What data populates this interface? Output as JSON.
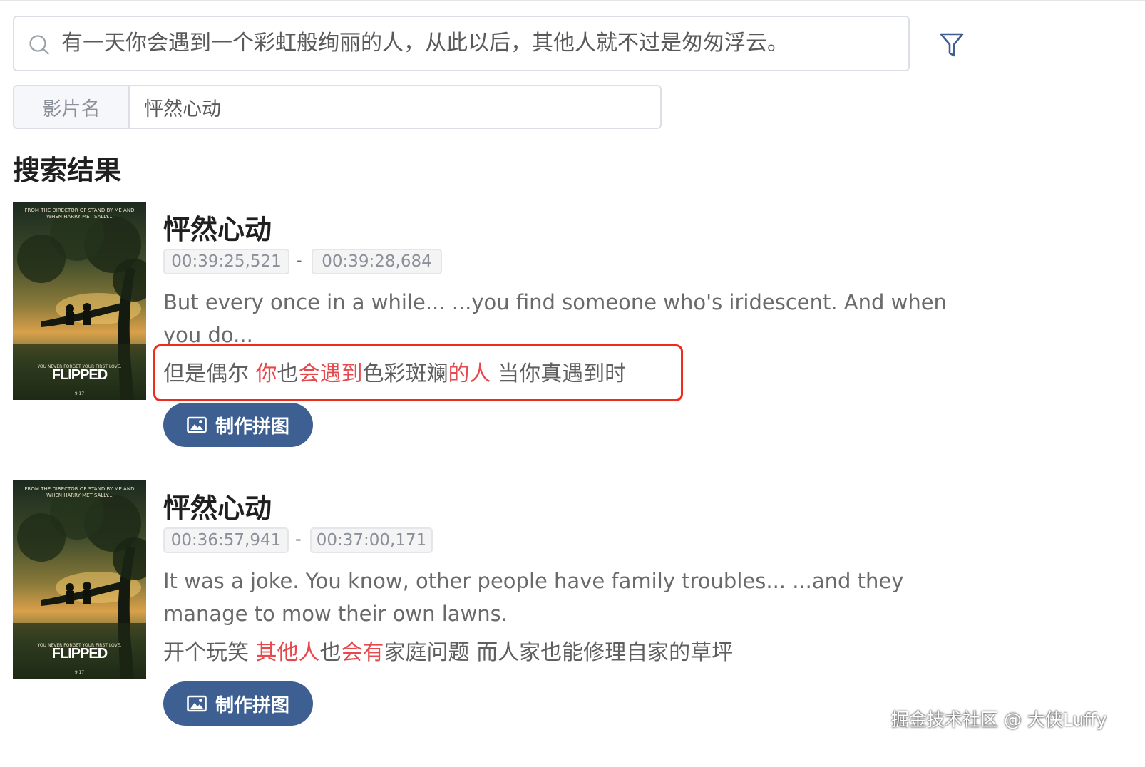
{
  "search": {
    "query": "有一天你会遇到一个彩虹般绚丽的人，从此以后，其他人就不过是匆匆浮云。",
    "title_filter_label": "影片名",
    "title_filter_value": "怦然心动"
  },
  "results_heading": "搜索结果",
  "results": [
    {
      "movie_title": "怦然心动",
      "start_time": "00:39:25,521",
      "end_time": "00:39:28,684",
      "english": "But every once in a while... ...you find someone who's iridescent. And when you do...",
      "chinese_parts": [
        {
          "text": "但是偶尔 ",
          "hl": false
        },
        {
          "text": "你",
          "hl": true
        },
        {
          "text": "也",
          "hl": false
        },
        {
          "text": "会遇到",
          "hl": true
        },
        {
          "text": "色彩斑斓",
          "hl": false
        },
        {
          "text": "的人",
          "hl": true
        },
        {
          "text": " 当你真遇到时",
          "hl": false
        }
      ],
      "button_label": "制作拼图",
      "annotated": true
    },
    {
      "movie_title": "怦然心动",
      "start_time": "00:36:57,941",
      "end_time": "00:37:00,171",
      "english": "It was a joke. You know, other people have family troubles... ...and they manage to mow their own lawns.",
      "chinese_parts": [
        {
          "text": "开个玩笑 ",
          "hl": false
        },
        {
          "text": "其他人",
          "hl": true
        },
        {
          "text": "也",
          "hl": false
        },
        {
          "text": "会有",
          "hl": true
        },
        {
          "text": "家庭问题 而人家也能修理自家的草坪",
          "hl": false
        }
      ],
      "button_label": "制作拼图",
      "annotated": false
    }
  ],
  "poster": {
    "top_text": "FROM THE DIRECTOR OF STAND BY ME AND WHEN HARRY MET SALLY...",
    "tagline": "YOU NEVER FORGET YOUR FIRST LOVE.",
    "title": "FLIPPED",
    "date": "9.17"
  },
  "watermark": "掘金技术社区 @ 大侠Luffy",
  "colors": {
    "highlight": "#e5484d",
    "button": "#3e5f92",
    "annotation": "#ee2c1c"
  }
}
